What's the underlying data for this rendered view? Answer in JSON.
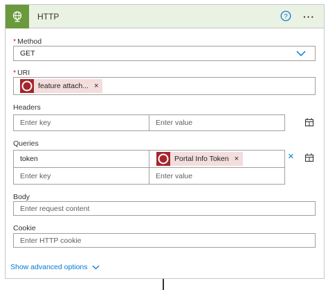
{
  "header": {
    "title": "HTTP",
    "accent_color": "#6a9a3c",
    "icon": "globe-icon",
    "help_icon": "help-icon",
    "more_label": "···"
  },
  "method": {
    "label": "Method",
    "required_marker": "*",
    "value": "GET"
  },
  "uri": {
    "label": "URI",
    "required_marker": "*",
    "token_label": "feature attach...",
    "token_remove": "×"
  },
  "headers": {
    "label": "Headers",
    "key_placeholder": "Enter key",
    "value_placeholder": "Enter value"
  },
  "queries": {
    "label": "Queries",
    "rows": [
      {
        "key": "token",
        "value_token": "Portal Info Token",
        "token_remove": "×",
        "remove": "×"
      }
    ],
    "key_placeholder": "Enter key",
    "value_placeholder": "Enter value"
  },
  "body": {
    "label": "Body",
    "placeholder": "Enter request content"
  },
  "cookie": {
    "label": "Cookie",
    "placeholder": "Enter HTTP cookie"
  },
  "advanced": {
    "label": "Show advanced options"
  }
}
